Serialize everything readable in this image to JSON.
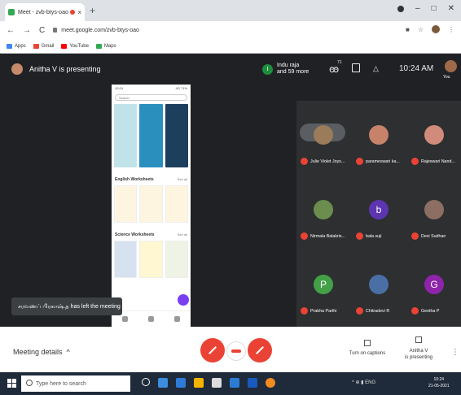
{
  "browser": {
    "tab_title": "Meet - zvb-btys-oao",
    "tab_close": "×",
    "new_tab": "+",
    "win_controls": {
      "minimize": "–",
      "maximize": "□",
      "close": "✕"
    },
    "nav": {
      "back": "←",
      "forward": "→",
      "reload": "C"
    },
    "url": "meet.google.com/zvb-btys-oao",
    "bookmarks": [
      {
        "label": "Apps",
        "color": "#4285f4"
      },
      {
        "label": "Gmail",
        "color": "#ea4335"
      },
      {
        "label": "YouTube",
        "color": "#ff0000"
      },
      {
        "label": "Maps",
        "color": "#34a853"
      }
    ]
  },
  "meet": {
    "presenting_text": "Anitha V is presenting",
    "top_user_initial": "I",
    "top_user_name_line1": "Indu raja",
    "top_user_name_line2": "and 59 more",
    "participant_count": "71",
    "people_glyph": "ꙭ",
    "activities_glyph": "△",
    "time": "10:24 AM",
    "you_label": "You",
    "toast": "சரவணப் பிரகாஷ்.த has left the meeting",
    "phone": {
      "status_left": "10:24",
      "status_right": "4G 71%",
      "search_placeholder": "Search",
      "sections": [
        {
          "title": "English Worksheets",
          "see_all": "See all"
        },
        {
          "title": "Science Worksheets",
          "see_all": "See all"
        }
      ]
    },
    "participants": [
      {
        "name": "Julie Violet Joys...",
        "avatar_color": "#9a7b5a",
        "initial": ""
      },
      {
        "name": "parameswari ka...",
        "avatar_color": "#c7826a",
        "initial": ""
      },
      {
        "name": "Rajeswari Nand...",
        "avatar_color": "#d08b7a",
        "initial": ""
      },
      {
        "name": "Nirmala Balakris...",
        "avatar_color": "#6b8e4e",
        "initial": ""
      },
      {
        "name": "bala suji",
        "avatar_color": "#5e35b1",
        "initial": "b"
      },
      {
        "name": "Devi Sudhan",
        "avatar_color": "#8d6e63",
        "initial": ""
      },
      {
        "name": "Prabha Parthi",
        "avatar_color": "#43a047",
        "initial": "P"
      },
      {
        "name": "Chitradevi R",
        "avatar_color": "#4a6fa5",
        "initial": ""
      },
      {
        "name": "Geetha P",
        "avatar_color": "#8e24aa",
        "initial": "G"
      }
    ],
    "bottom": {
      "meeting_details": "Meeting details",
      "chevron": "^",
      "turn_on_captions": "Turn on captions",
      "presenter_line1": "Anitha V",
      "presenter_line2": "is presenting",
      "more": "⋮"
    }
  },
  "taskbar": {
    "search_placeholder": "Type here to search",
    "apps": [
      "#ffffff",
      "#3c8dde",
      "#f4b400",
      "#2b7cd3",
      "#185abd",
      "#f28b20"
    ],
    "tray_text": "^ ⊕ ▮ ENG",
    "clock_time": "10:24",
    "clock_date": "21-05-2021"
  }
}
